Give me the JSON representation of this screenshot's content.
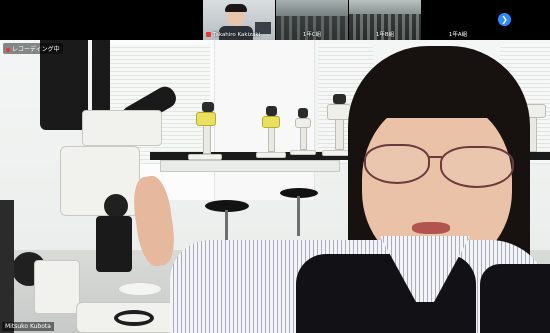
{
  "participants": [
    {
      "name": "",
      "muted": false
    },
    {
      "name": "Takahiro Kakizaki",
      "muted": true
    },
    {
      "name": "1年C組",
      "muted": false
    },
    {
      "name": "1年B組",
      "muted": false
    },
    {
      "name": "1年A組",
      "muted": false
    }
  ],
  "main": {
    "recording_label": "レコーディング中",
    "speaker_name": "Mitsuko Kubota"
  },
  "icons": {
    "next": "chevron-right-icon"
  },
  "colors": {
    "accent": "#2d8cff",
    "recording": "#e53935"
  }
}
